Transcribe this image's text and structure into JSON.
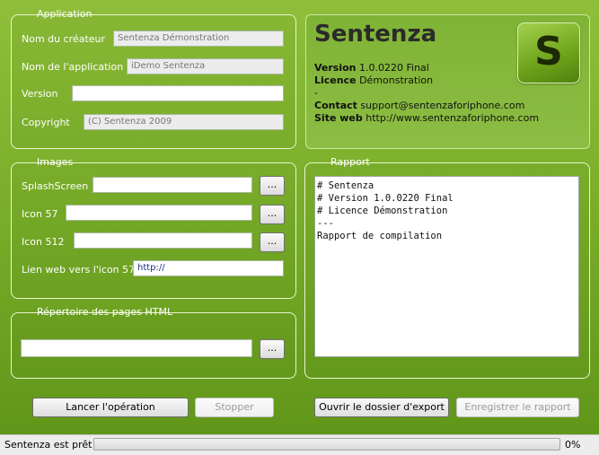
{
  "application": {
    "legend": "Application",
    "creator_label": "Nom du créateur",
    "creator_value": "Sentenza Démonstration",
    "appname_label": "Nom de l'application",
    "appname_value": "iDemo Sentenza",
    "version_label": "Version",
    "version_value": "",
    "copyright_label": "Copyright",
    "copyright_value": "(C) Sentenza 2009"
  },
  "info": {
    "title": "Sentenza",
    "version_key": "Version",
    "version_val": " 1.0.0220 Final",
    "licence_key": "Licence",
    "licence_val": " Démonstration",
    "dash": "-",
    "contact_key": "Contact",
    "contact_val": " support@sentenzaforiphone.com",
    "site_key": "Site web",
    "site_val": " http://www.sentenzaforiphone.com",
    "logo_letter": "S"
  },
  "images": {
    "legend": "Images",
    "splash_label": "SplashScreen",
    "icon57_label": "Icon 57",
    "icon512_label": "Icon 512",
    "weblink_label": "Lien web vers l'icon 57",
    "weblink_value": "http://",
    "browse_label": "..."
  },
  "html_dir": {
    "legend": "Répertoire des pages HTML",
    "value": "",
    "browse_label": "..."
  },
  "report": {
    "legend": "Rapport",
    "text": "# Sentenza\n# Version 1.0.0220 Final\n# Licence Démonstration\n---\nRapport de compilation"
  },
  "buttons": {
    "launch": "Lancer l'opération",
    "stop": "Stopper",
    "open_export": "Ouvrir le dossier d'export",
    "save_report": "Enregistrer le rapport"
  },
  "status": {
    "text": "Sentenza est prêt !",
    "progress_percent": 0,
    "progress_label": "0%"
  }
}
